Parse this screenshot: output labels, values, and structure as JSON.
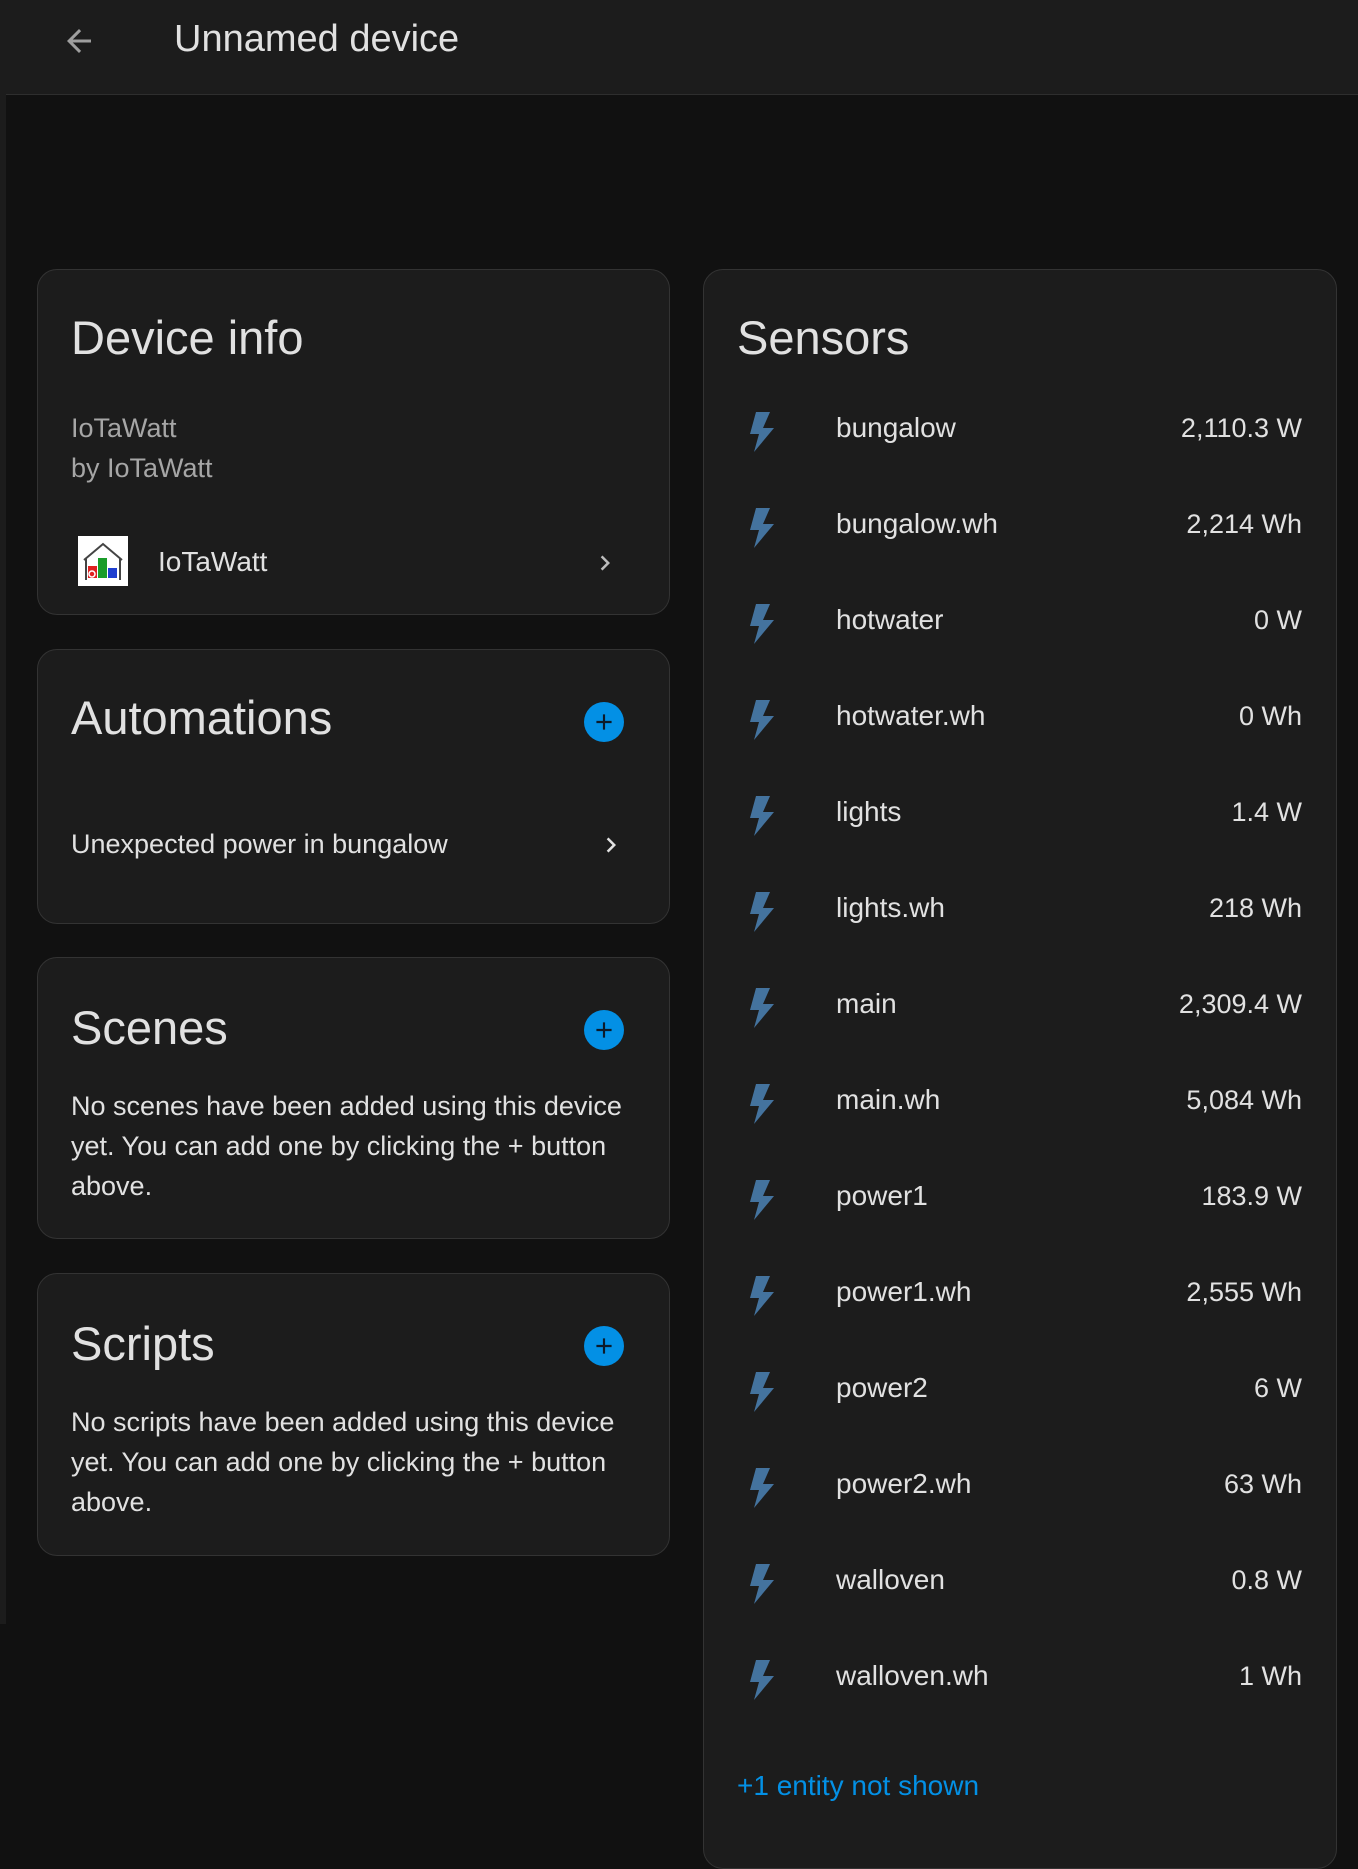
{
  "header": {
    "title": "Unnamed device",
    "back_icon": "arrow-left-icon"
  },
  "device_info": {
    "title": "Device info",
    "model": "IoTaWatt",
    "manufacturer": "by IoTaWatt",
    "integration": {
      "label": "IoTaWatt",
      "icon": "iotawatt-logo"
    }
  },
  "automations": {
    "title": "Automations",
    "items": [
      {
        "label": "Unexpected power in bungalow"
      }
    ]
  },
  "scenes": {
    "title": "Scenes",
    "empty_text": "No scenes have been added using this device yet. You can add one by clicking the + button above."
  },
  "scripts": {
    "title": "Scripts",
    "empty_text": "No scripts have been added using this device yet. You can add one by clicking the + button above."
  },
  "sensors": {
    "title": "Sensors",
    "icon": "flash-icon",
    "items": [
      {
        "name": "bungalow",
        "value": "2,110.3 W"
      },
      {
        "name": "bungalow.wh",
        "value": "2,214 Wh"
      },
      {
        "name": "hotwater",
        "value": "0 W"
      },
      {
        "name": "hotwater.wh",
        "value": "0 Wh"
      },
      {
        "name": "lights",
        "value": "1.4 W"
      },
      {
        "name": "lights.wh",
        "value": "218 Wh"
      },
      {
        "name": "main",
        "value": "2,309.4 W"
      },
      {
        "name": "main.wh",
        "value": "5,084 Wh"
      },
      {
        "name": "power1",
        "value": "183.9 W"
      },
      {
        "name": "power1.wh",
        "value": "2,555 Wh"
      },
      {
        "name": "power2",
        "value": "6 W"
      },
      {
        "name": "power2.wh",
        "value": "63 Wh"
      },
      {
        "name": "walloven",
        "value": "0.8 W"
      },
      {
        "name": "walloven.wh",
        "value": "1 Wh"
      }
    ],
    "hidden_link": "+1 entity not shown"
  },
  "colors": {
    "background": "#111111",
    "card": "#1c1c1c",
    "accent": "#0390e5",
    "sensor_icon": "#44739e",
    "text": "#e1e1e1",
    "secondary_text": "#a6a6a6"
  }
}
